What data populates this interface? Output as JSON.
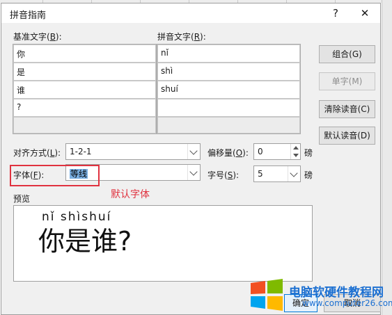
{
  "dialog": {
    "title": "拼音指南",
    "help_label": "?",
    "close_label": "✕"
  },
  "columns": {
    "base_label": "基准文字(B):",
    "base_key": "B",
    "ruby_label": "拼音文字(R):",
    "ruby_key": "R"
  },
  "rows": [
    {
      "base": "你",
      "ruby": "nǐ"
    },
    {
      "base": "是",
      "ruby": "shì"
    },
    {
      "base": "谁",
      "ruby": "shuí"
    },
    {
      "base": "?",
      "ruby": ""
    }
  ],
  "buttons": {
    "group": "组合(G)",
    "mono": "单字(M)",
    "clear": "清除读音(C)",
    "default": "默认读音(D)"
  },
  "options": {
    "alignment_label": "对齐方式(L):",
    "alignment_value": "1-2-1",
    "offset_label": "偏移量(O):",
    "offset_value": "0",
    "offset_unit": "磅",
    "font_label": "字体(F):",
    "font_value": "等线",
    "size_label": "字号(S):",
    "size_value": "5",
    "size_unit": "磅"
  },
  "annotation": "默认字体",
  "preview": {
    "label": "预览",
    "pinyin": "nǐ shìshuí",
    "text": "你是谁?"
  },
  "footer": {
    "ok": "确定",
    "cancel": "取消"
  },
  "watermark": {
    "text": "电脑软硬件教程网",
    "url": "www.computer26.com"
  },
  "colors": {
    "annotation_red": "#e0323f",
    "selection_blue": "#7ab0e3",
    "watermark_blue": "#1b6fd1"
  }
}
